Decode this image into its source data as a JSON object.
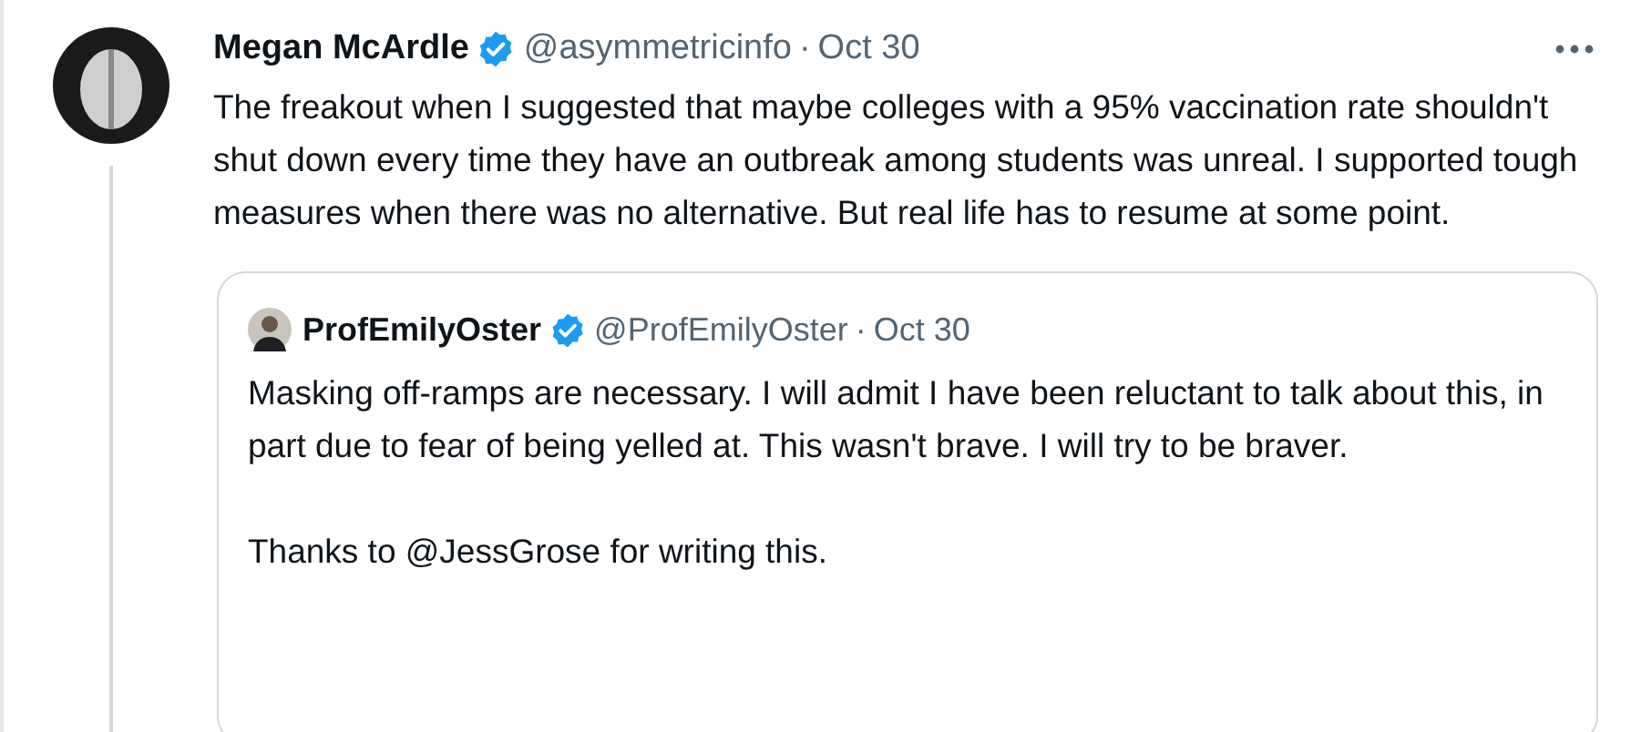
{
  "tweet": {
    "author_name": "Megan McArdle",
    "verified": true,
    "handle": "@asymmetricinfo",
    "separator": "·",
    "date": "Oct 30",
    "paragraphs": [
      "The freakout when I suggested that maybe colleges with a 95% vaccination rate shouldn't shut down every time they have an outbreak among students was unreal. I supported tough measures when there was no alternative. But real life has to resume at some point."
    ],
    "quoted_tweet": {
      "author_name": "ProfEmilyOster",
      "verified": true,
      "handle": "@ProfEmilyOster",
      "separator": "·",
      "date": "Oct 30",
      "paragraphs": [
        "Masking off-ramps are necessary. I will admit I have been reluctant to talk about this, in part due to fear of being yelled at. This wasn't brave. I will try to be braver.",
        "Thanks to @JessGrose for writing this."
      ]
    }
  }
}
